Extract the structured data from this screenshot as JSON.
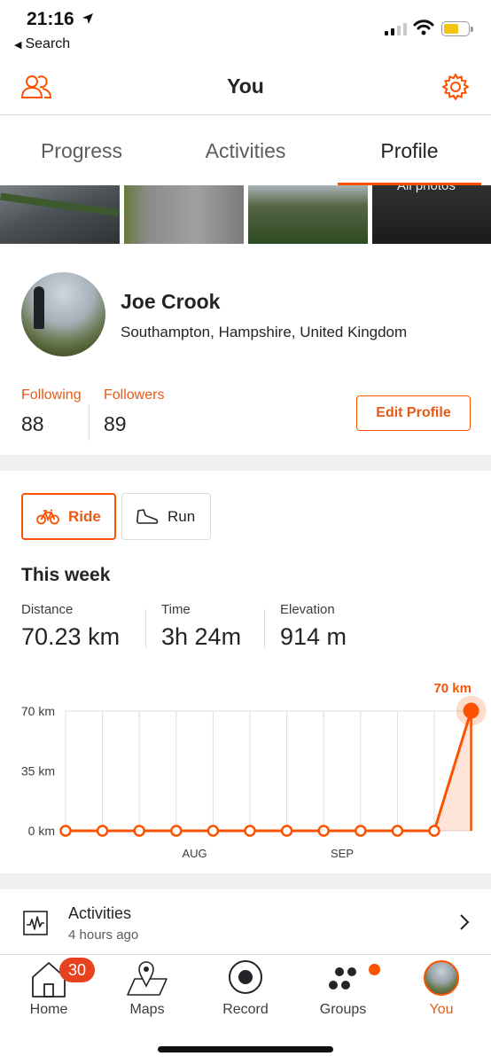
{
  "status_bar": {
    "time": "21:16",
    "back_label": "Search"
  },
  "header": {
    "title": "You"
  },
  "tabs": [
    {
      "label": "Progress",
      "active": false
    },
    {
      "label": "Activities",
      "active": false
    },
    {
      "label": "Profile",
      "active": true
    }
  ],
  "photos": {
    "all_photos_label": "All photos"
  },
  "profile": {
    "name": "Joe Crook",
    "location": "Southampton, Hampshire, United Kingdom",
    "following_label": "Following",
    "following_count": "88",
    "followers_label": "Followers",
    "followers_count": "89",
    "edit_label": "Edit Profile"
  },
  "weekly": {
    "sports": [
      {
        "label": "Ride",
        "active": true
      },
      {
        "label": "Run",
        "active": false
      }
    ],
    "title": "This week",
    "stats": [
      {
        "label": "Distance",
        "value": "70.23 km"
      },
      {
        "label": "Time",
        "value": "3h 24m"
      },
      {
        "label": "Elevation",
        "value": "914 m"
      }
    ]
  },
  "chart_data": {
    "type": "line",
    "title": "",
    "xlabel": "",
    "ylabel": "",
    "x": [
      1,
      2,
      3,
      4,
      5,
      6,
      7,
      8,
      9,
      10,
      11,
      12
    ],
    "x_tick_labels": [
      {
        "label": "AUG",
        "position": 4
      },
      {
        "label": "SEP",
        "position": 8
      }
    ],
    "y_ticks": [
      "0 km",
      "35 km",
      "70 km"
    ],
    "ylim": [
      0,
      70
    ],
    "series": [
      {
        "values": [
          0,
          0,
          0,
          0,
          0,
          0,
          0,
          0,
          0,
          0,
          0,
          70.23
        ]
      }
    ],
    "current_label": "70 km",
    "grid": true,
    "accent_color": "#fc5200"
  },
  "activities_row": {
    "title": "Activities",
    "subtitle": "4 hours ago"
  },
  "tab_bar": [
    {
      "label": "Home",
      "badge": "30",
      "active": false
    },
    {
      "label": "Maps",
      "active": false
    },
    {
      "label": "Record",
      "active": false
    },
    {
      "label": "Groups",
      "active": false
    },
    {
      "label": "You",
      "active": true
    }
  ],
  "colors": {
    "accent": "#fc5200",
    "badge": "#e8411f",
    "divider": "#dcdcdc"
  }
}
